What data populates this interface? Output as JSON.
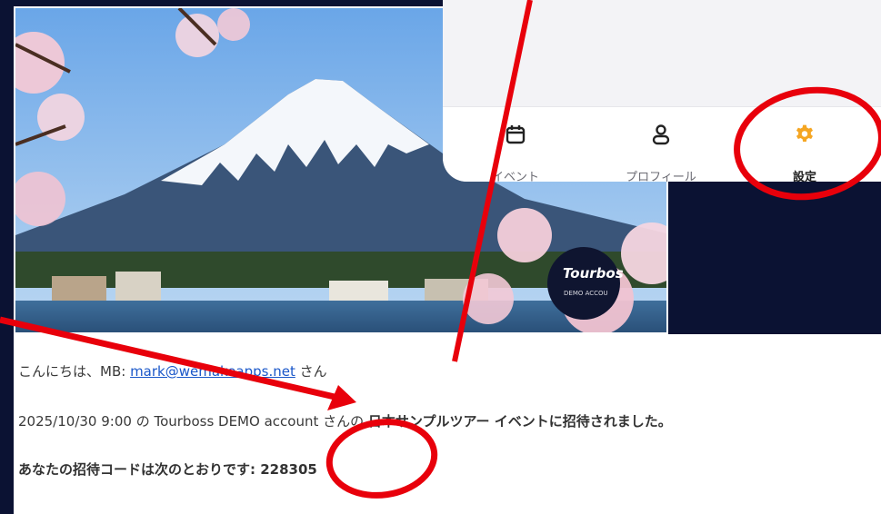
{
  "hero": {
    "logo_text": "Tourbos",
    "logo_sub": "DEMO ACCOU"
  },
  "tabs": [
    {
      "label": "イベント",
      "icon": "calendar-icon"
    },
    {
      "label": "プロフィール",
      "icon": "person-icon"
    },
    {
      "label": "設定",
      "icon": "gear-icon",
      "active": true
    }
  ],
  "colors": {
    "active_icon": "#f5a623",
    "annotation_red": "#e8000b",
    "link": "#1a57c9"
  },
  "email": {
    "greeting_prefix": "こんにちは、MB: ",
    "greeting_email": "mark@wemakeapps.net",
    "greeting_suffix": " さん",
    "invite_datetime": "2025/10/30 9:00",
    "invite_of": " の ",
    "invite_host": "Tourboss DEMO account",
    "invite_host_suffix": " さんの ",
    "invite_event": "日本サンプルツアー",
    "invite_suffix": " イベントに招待されました。",
    "code_label": "あなたの招待コードは次のとおりです: ",
    "code_value": "228305"
  }
}
